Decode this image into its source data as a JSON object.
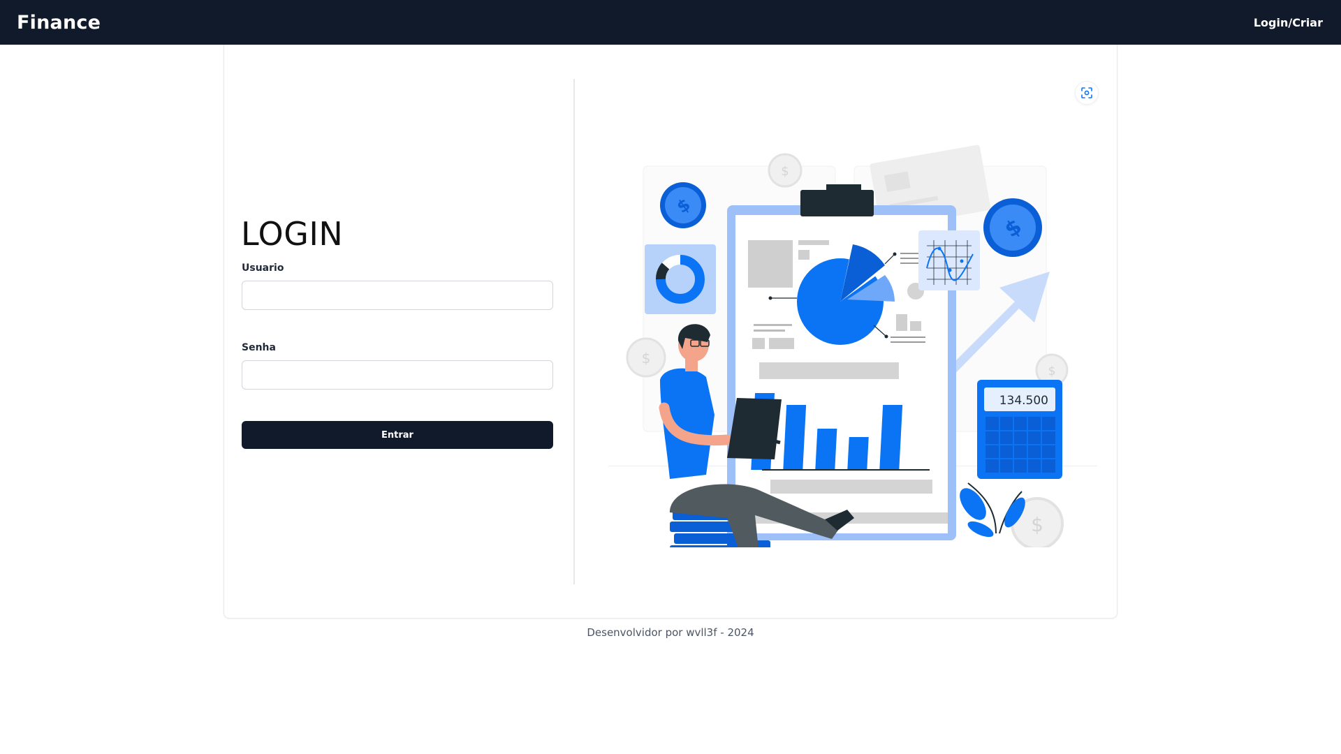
{
  "navbar": {
    "brand": "Finance",
    "link": "Login/Criar"
  },
  "login": {
    "title": "LOGIN",
    "username_label": "Usuario",
    "username_value": "",
    "password_label": "Senha",
    "password_value": "",
    "submit_label": "Entrar"
  },
  "illustration": {
    "calculator_display": "134.500",
    "dollar_sign": "$"
  },
  "footer": {
    "text": "Desenvolvidor por wvll3f - 2024"
  },
  "colors": {
    "navbar": "#111a2b",
    "accent_blue": "#0a74f5",
    "dark_button": "#111a2b"
  },
  "icons": {
    "scan": "scan-icon"
  }
}
